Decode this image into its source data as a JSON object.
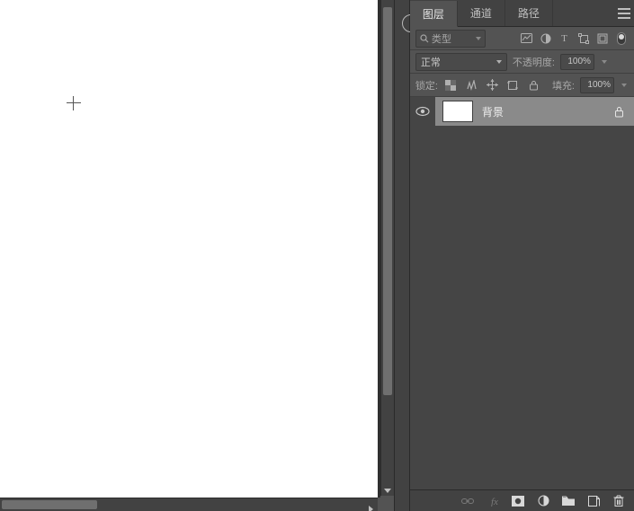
{
  "tabs": {
    "layers": "图层",
    "channels": "通道",
    "paths": "路径"
  },
  "filter": {
    "placeholder": "类型"
  },
  "blend": {
    "mode": "正常",
    "opacity_label": "不透明度:",
    "opacity_value": "100%"
  },
  "lock": {
    "label": "锁定:",
    "fill_label": "填充:",
    "fill_value": "100%"
  },
  "layer0": {
    "name": "背景"
  }
}
